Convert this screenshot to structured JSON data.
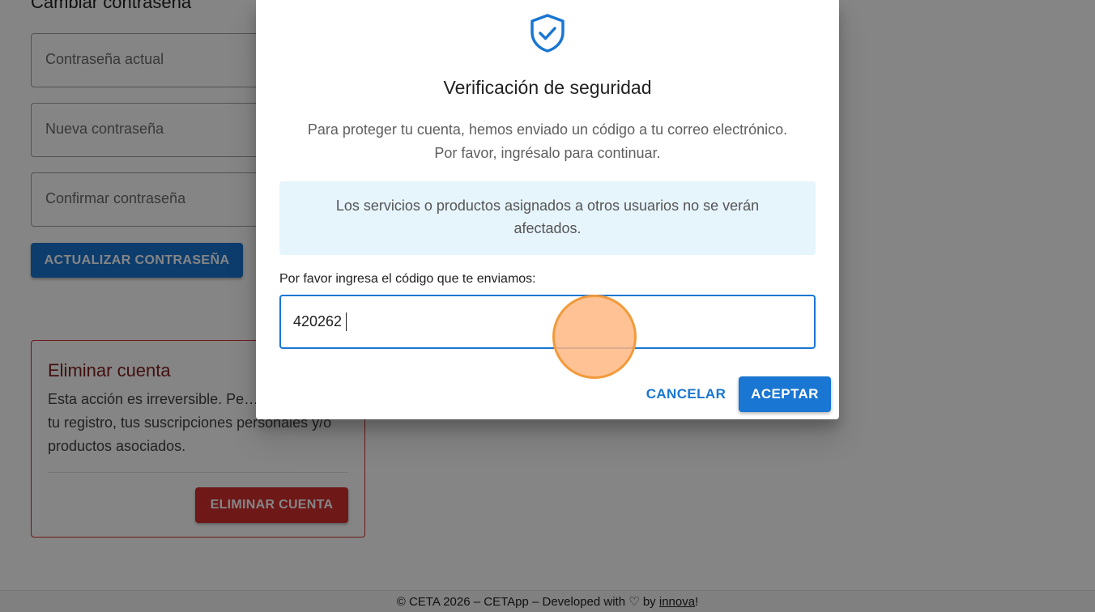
{
  "background": {
    "password_section": {
      "title": "Cambiar contraseña",
      "current_password_placeholder": "Contraseña actual",
      "new_password_placeholder": "Nueva contraseña",
      "confirm_password_placeholder": "Confirmar contraseña",
      "update_button": "ACTUALIZAR CONTRASEÑA"
    },
    "delete_account": {
      "title": "Eliminar cuenta",
      "description": "Esta acción es irreversible. Pe… los datos de tu registro, tus suscripciones personales y/o productos asociados.",
      "delete_button": "ELIMINAR CUENTA"
    },
    "footer": {
      "text": "© CETA 2026 – CETApp – Developed with ♡ by ",
      "link": "innova",
      "suffix": "!"
    }
  },
  "dialog": {
    "icon": "shield-check-icon",
    "title": "Verificación de seguridad",
    "message_line1": "Para proteger tu cuenta, hemos enviado un código a tu correo electrónico.",
    "message_line2": "Por favor, ingrésalo para continuar.",
    "info": "Los servicios o productos asignados a otros usuarios no se verán afectados.",
    "code_label": "Por favor ingresa el código que te enviamos:",
    "code_value": "420262",
    "cancel_button": "CANCELAR",
    "accept_button": "ACEPTAR"
  },
  "colors": {
    "primary": "#1976d2",
    "danger": "#d32f2f",
    "info_bg": "#e6f4fc"
  }
}
